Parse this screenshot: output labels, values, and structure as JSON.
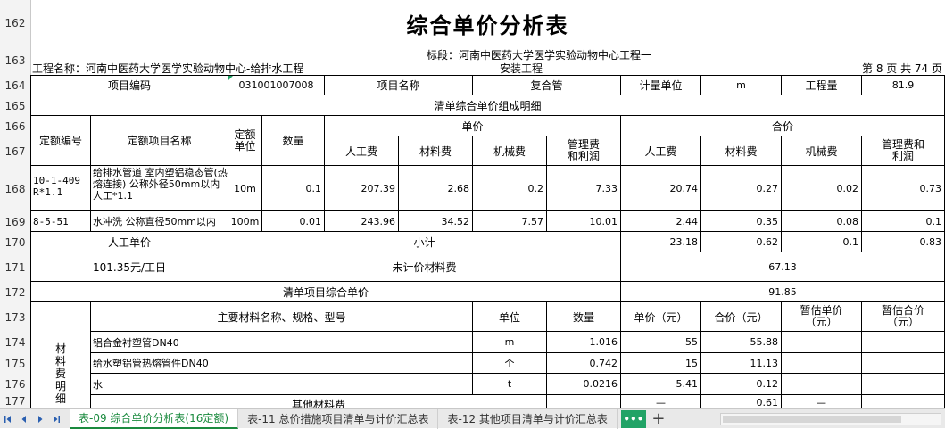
{
  "row_numbers": [
    "162",
    "163",
    "164",
    "165",
    "166",
    "167",
    "168",
    "169",
    "170",
    "171",
    "172",
    "173",
    "174",
    "175",
    "176",
    "177"
  ],
  "sheet": {
    "title": "综合单价分析表",
    "section": "标段：河南中医药大学医学实验动物中心工程一",
    "project_name": "工程名称：河南中医药大学医学实验动物中心-给排水工程",
    "install": "安装工程",
    "page_info": "第 8 页  共 74 页",
    "row164": {
      "item_code_label": "项目编码",
      "item_code": "031001007008",
      "item_name_label": "项目名称",
      "item_name": "复合管",
      "unit_label": "计量单位",
      "unit": "m",
      "qty_label": "工程量",
      "qty": "81.9"
    },
    "detail_header": "清单综合单价组成明细",
    "hdr": {
      "quota_no": "定额编号",
      "quota_name": "定额项目名称",
      "quota_unit": "定额单位",
      "quantity": "数量",
      "unit_price": "单价",
      "total": "合价",
      "labor": "人工费",
      "material": "材料费",
      "machine": "机械费",
      "mgmt": "管理费和利润"
    },
    "rows": [
      {
        "no": "10-1-409 R*1.1",
        "name": "给排水管道 室内塑铝稳态管(热熔连接) 公称外径50mm以内  人工*1.1",
        "unit": "10m",
        "qty": "0.1",
        "labor": "207.39",
        "material": "2.68",
        "machine": "0.2",
        "mgmt": "7.33",
        "t_labor": "20.74",
        "t_material": "0.27",
        "t_machine": "0.02",
        "t_mgmt": "0.73"
      },
      {
        "no": "8-5-51",
        "name": "水冲洗 公称直径50mm以内",
        "unit": "100m",
        "qty": "0.01",
        "labor": "243.96",
        "material": "34.52",
        "machine": "7.57",
        "mgmt": "10.01",
        "t_labor": "2.44",
        "t_material": "0.35",
        "t_machine": "0.08",
        "t_mgmt": "0.1"
      }
    ],
    "labor_unit_label": "人工单价",
    "subtotal_label": "小计",
    "subtotal": {
      "labor": "23.18",
      "material": "0.62",
      "machine": "0.1",
      "mgmt": "0.83"
    },
    "labor_unit_value": "101.35元/工日",
    "unpriced_label": "未计价材料费",
    "unpriced_value": "67.13",
    "composite_label": "清单项目综合单价",
    "composite_value": "91.85",
    "mat_side": "材料费明细",
    "mat_hdr": {
      "name": "主要材料名称、规格、型号",
      "unit": "单位",
      "qty": "数量",
      "price": "单价（元）",
      "total": "合价（元）",
      "est_price": "暂估单价（元）",
      "est_total": "暂估合价（元）"
    },
    "materials": [
      {
        "name": "铝合金衬塑管DN40",
        "unit": "m",
        "qty": "1.016",
        "price": "55",
        "total": "55.88"
      },
      {
        "name": "给水塑铝管热熔管件DN40",
        "unit": "个",
        "qty": "0.742",
        "price": "15",
        "total": "11.13"
      },
      {
        "name": "水",
        "unit": "t",
        "qty": "0.0216",
        "price": "5.41",
        "total": "0.12"
      }
    ],
    "other_label": "其他材料费",
    "other_value": "0.61",
    "other_dash": "—"
  },
  "tabs": [
    {
      "label": "表-09 综合单价分析表(16定额)",
      "active": true
    },
    {
      "label": "表-11 总价措施项目清单与计价汇总表",
      "active": false
    },
    {
      "label": "表-12 其他项目清单与计价汇总表",
      "active": false
    }
  ],
  "nav_icons": [
    "first-sheet-icon",
    "prev-sheet-icon",
    "next-sheet-icon",
    "last-sheet-icon"
  ],
  "more_label": "•••",
  "add_label": "+",
  "colors": {
    "accent": "#21a366",
    "active_tab_text": "#1a8a3e"
  }
}
